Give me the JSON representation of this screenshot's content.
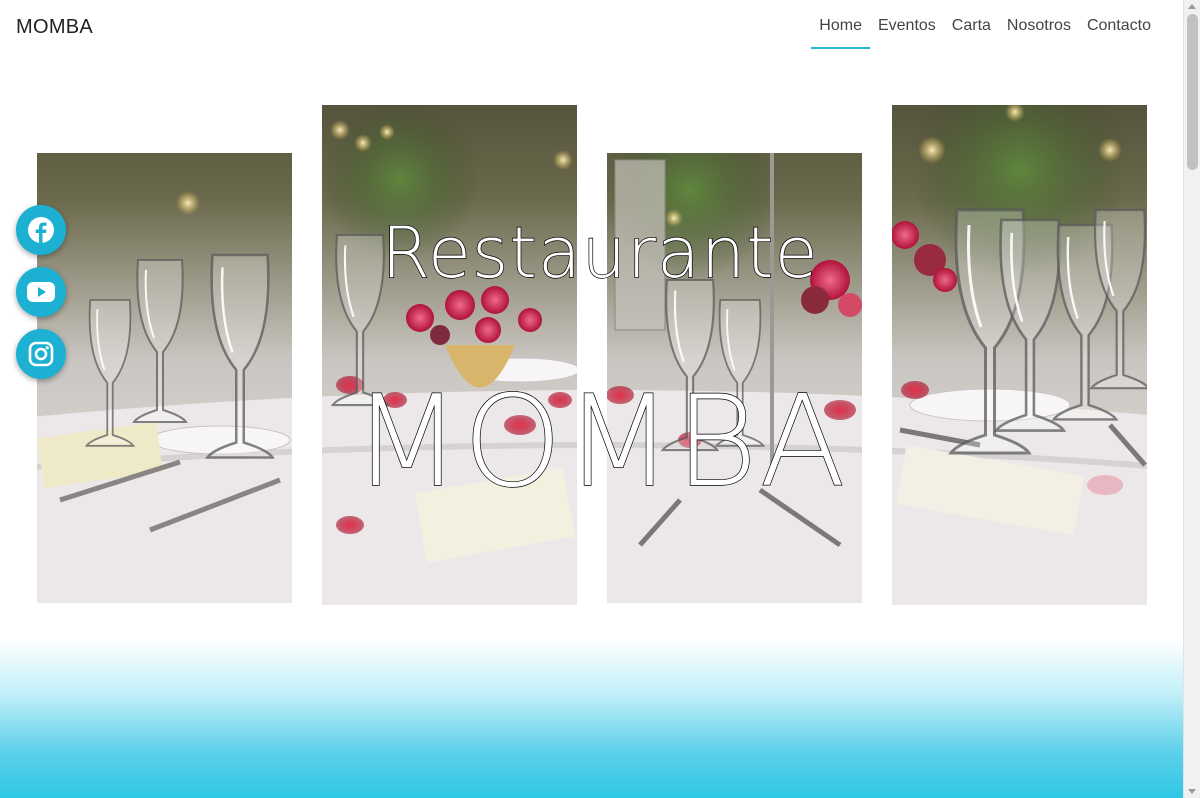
{
  "header": {
    "brand": "MOMBA",
    "nav": [
      {
        "label": "Home",
        "active": true
      },
      {
        "label": "Eventos",
        "active": false
      },
      {
        "label": "Carta",
        "active": false
      },
      {
        "label": "Nosotros",
        "active": false
      },
      {
        "label": "Contacto",
        "active": false
      }
    ]
  },
  "hero": {
    "title_line1": "Restaurante",
    "title_line2": "MOMBA",
    "image_icon": "table-setting-photo"
  },
  "social": [
    {
      "icon": "facebook-icon"
    },
    {
      "icon": "youtube-icon"
    },
    {
      "icon": "instagram-icon"
    }
  ],
  "colors": {
    "accent": "#29b6d6",
    "social_bg": "#1cb1d3",
    "band_bottom": "#2ec7e6"
  }
}
